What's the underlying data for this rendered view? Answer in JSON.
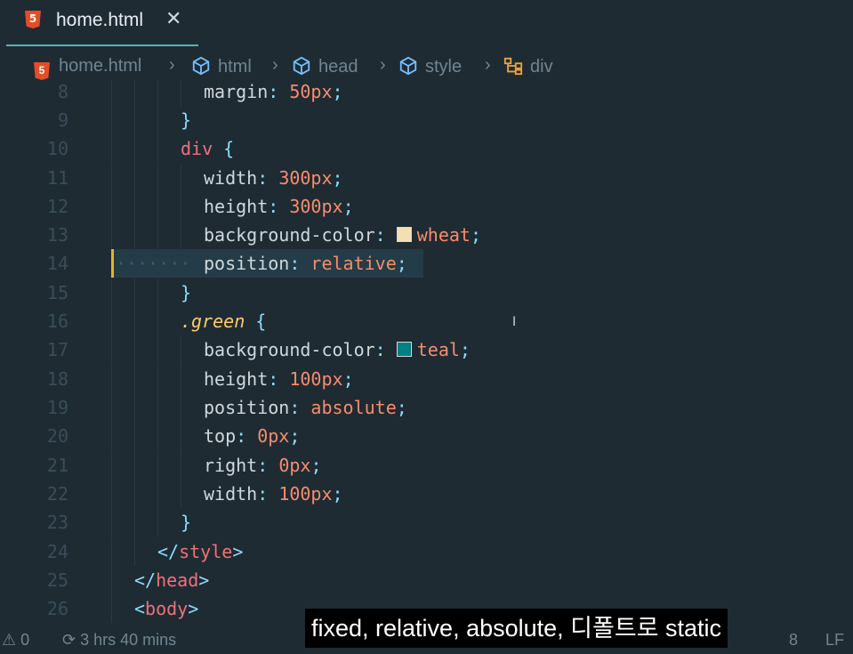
{
  "tab": {
    "title": "home.html",
    "close": "✕",
    "file_icon": "html5-icon"
  },
  "breadcrumb": {
    "items": [
      {
        "label": "home.html",
        "icon": "html5-icon"
      },
      {
        "label": "html",
        "icon": "cube-icon"
      },
      {
        "label": "head",
        "icon": "cube-icon"
      },
      {
        "label": "style",
        "icon": "cube-icon"
      },
      {
        "label": "div",
        "icon": "selector-icon"
      }
    ],
    "separator": "›"
  },
  "editor": {
    "cursor_line": 14,
    "line_numbers": [
      "8",
      "9",
      "10",
      "11",
      "12",
      "13",
      "14",
      "15",
      "16",
      "17",
      "18",
      "19",
      "20",
      "21",
      "22",
      "23",
      "24",
      "25",
      "26"
    ],
    "lines": {
      "l8": {
        "prop": "margin",
        "colon": ":",
        "value": "50px",
        "semi": ";"
      },
      "l9": {
        "brace": "}"
      },
      "l10": {
        "selector": "div",
        "brace": "{"
      },
      "l11": {
        "prop": "width",
        "colon": ":",
        "value": "300px",
        "semi": ";"
      },
      "l12": {
        "prop": "height",
        "colon": ":",
        "value": "300px",
        "semi": ";"
      },
      "l13": {
        "prop": "background-color",
        "colon": ":",
        "value": "wheat",
        "semi": ";",
        "swatch": "#f5deb3"
      },
      "l14": {
        "dots": "·······",
        "prop": "position",
        "colon": ":",
        "value": "relative",
        "semi": ";"
      },
      "l15": {
        "brace": "}"
      },
      "l16": {
        "selector": ".green",
        "brace": "{"
      },
      "l17": {
        "prop": "background-color",
        "colon": ":",
        "value": "teal",
        "semi": ";",
        "swatch": "#008080"
      },
      "l18": {
        "prop": "height",
        "colon": ":",
        "value": "100px",
        "semi": ";"
      },
      "l19": {
        "prop": "position",
        "colon": ":",
        "value": "absolute",
        "semi": ";"
      },
      "l20": {
        "prop": "top",
        "colon": ":",
        "value": "0px",
        "semi": ";"
      },
      "l21": {
        "prop": "right",
        "colon": ":",
        "value": "0px",
        "semi": ";"
      },
      "l22": {
        "prop": "width",
        "colon": ":",
        "value": "100px",
        "semi": ";"
      },
      "l23": {
        "brace": "}"
      },
      "l24": {
        "open": "</",
        "tag": "style",
        "close": ">"
      },
      "l25": {
        "open": "</",
        "tag": "head",
        "close": ">"
      },
      "l26": {
        "open": "<",
        "tag": "body",
        "close": ">"
      }
    }
  },
  "status": {
    "problems": "0",
    "time": "3 hrs 40 mins",
    "indent": "8",
    "eol": "LF"
  },
  "subtitle": "fixed, relative, absolute, 디폴트로 static",
  "colors": {
    "background": "#1f2b33",
    "accent": "#4fb7b6",
    "selector": "#f07178",
    "value": "#f78c6c",
    "class": "#ffcb6b",
    "punctuation": "#89ddff"
  }
}
